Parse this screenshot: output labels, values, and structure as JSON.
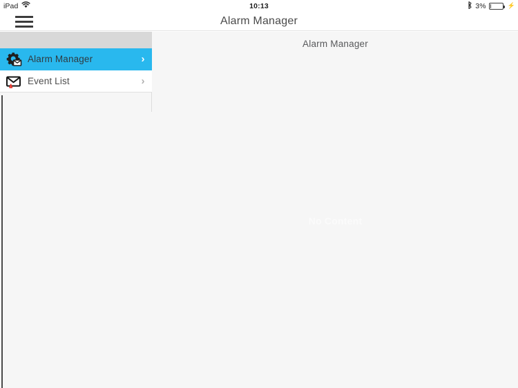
{
  "statusbar": {
    "device_label": "iPad",
    "wifi_icon": "wifi-icon",
    "time": "10:13",
    "bluetooth_icon": "bluetooth-icon",
    "battery_percent": "3%",
    "battery_level": 3,
    "charging_icon": "lightning-charging-icon"
  },
  "navbar": {
    "menu_icon": "hamburger-menu-icon",
    "title": "Alarm Manager"
  },
  "sidebar": {
    "items": [
      {
        "label": "Alarm Manager",
        "icon": "gear-mail-icon",
        "chevron": "›",
        "selected": true
      },
      {
        "label": "Event List",
        "icon": "envelope-alert-icon",
        "chevron": "›",
        "selected": false
      }
    ]
  },
  "content": {
    "title": "Alarm Manager",
    "empty_text": "No Content"
  },
  "colors": {
    "accent_blue": "#29b8ee",
    "sidebar_bg": "#f6f6f6",
    "header_strip": "#d8d8d8",
    "alert_red": "#e8352b",
    "text_gray": "#4c4c4c"
  }
}
